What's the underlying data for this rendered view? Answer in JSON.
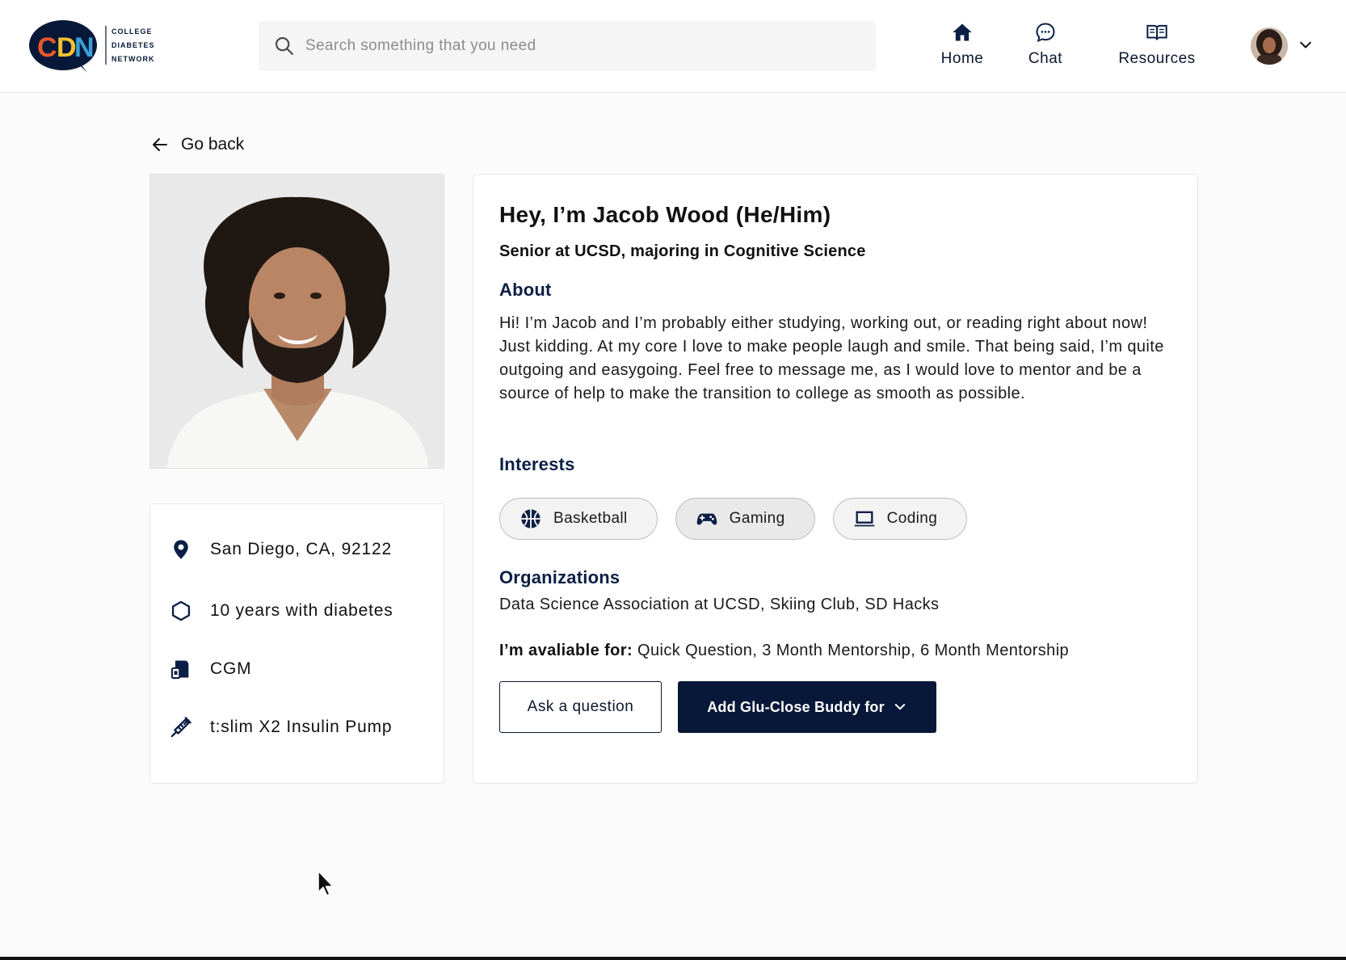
{
  "brand": {
    "logo_letters": "CDN",
    "logo_line1": "COLLEGE",
    "logo_line2": "DIABETES",
    "logo_line3": "NETWORK",
    "colors": {
      "navy": "#071838",
      "c": "#e8582a",
      "d": "#f2c230",
      "n": "#3aa0d8"
    }
  },
  "search": {
    "placeholder": "Search something that you need",
    "icon": "search-icon"
  },
  "nav": {
    "home": {
      "label": "Home",
      "icon": "home-icon"
    },
    "chat": {
      "label": "Chat",
      "icon": "chat-bubble-icon"
    },
    "resources": {
      "label": "Resources",
      "icon": "book-icon"
    }
  },
  "back": {
    "label": "Go back"
  },
  "profile": {
    "name": "Hey, I’m Jacob Wood (He/Him)",
    "subtitle": "Senior at UCSD, majoring in Cognitive Science",
    "about_heading": "About",
    "about_text": "Hi! I’m Jacob and I’m probably either studying, working out, or reading right about now! Just kidding. At my core I love to make people laugh and smile. That being said, I’m quite outgoing and easygoing. Feel free to message me, as I would love to mentor and be a source of help to make the transition to college as smooth as possible.",
    "interests_heading": "Interests",
    "interests": [
      {
        "label": "Basketball",
        "icon": "basketball-icon"
      },
      {
        "label": "Gaming",
        "icon": "gamepad-icon"
      },
      {
        "label": "Coding",
        "icon": "laptop-icon"
      }
    ],
    "organizations_heading": "Organizations",
    "organizations": "Data Science Association at UCSD, Skiing Club, SD Hacks",
    "available_label": "I’m avaliable for:",
    "available_value": " Quick Question, 3 Month Mentorship, 6 Month Mentorship"
  },
  "info": {
    "location": "San Diego, CA, 92122",
    "years": "10 years with diabetes",
    "device": "CGM",
    "pump": "t:slim X2 Insulin Pump"
  },
  "actions": {
    "ask": "Ask a question",
    "add": "Add Glu-Close Buddy for"
  }
}
